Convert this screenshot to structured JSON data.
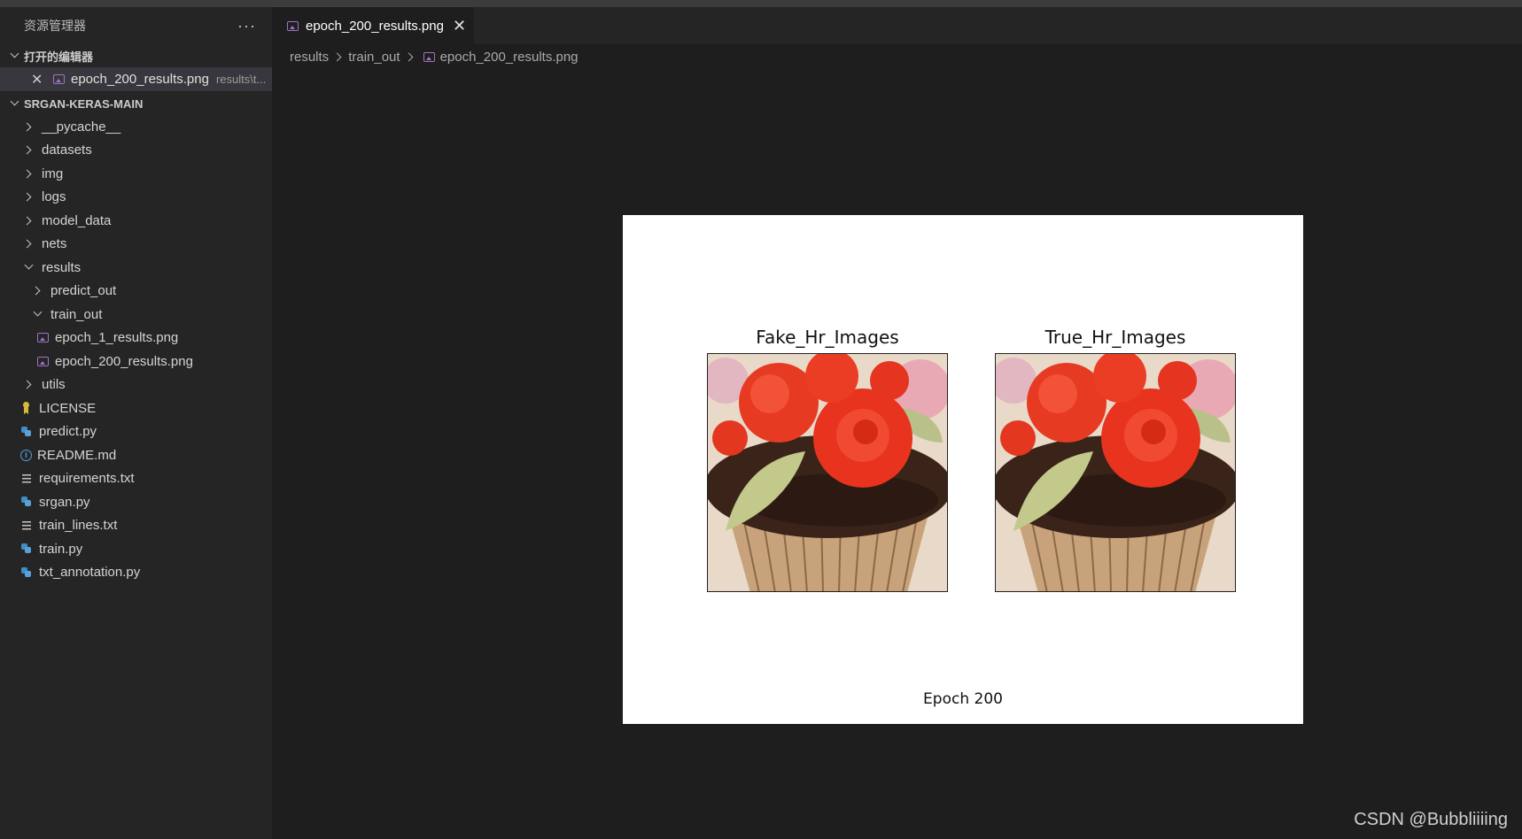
{
  "sidebar": {
    "title": "资源管理器",
    "more_label": "···",
    "open_editors": {
      "label": "打开的编辑器",
      "items": [
        {
          "name": "epoch_200_results.png",
          "path": "results\\t..."
        }
      ]
    },
    "project": {
      "label": "SRGAN-KERAS-MAIN",
      "tree": [
        {
          "label": "__pycache__",
          "type": "folder"
        },
        {
          "label": "datasets",
          "type": "folder"
        },
        {
          "label": "img",
          "type": "folder"
        },
        {
          "label": "logs",
          "type": "folder"
        },
        {
          "label": "model_data",
          "type": "folder"
        },
        {
          "label": "nets",
          "type": "folder"
        },
        {
          "label": "results",
          "type": "folder-open"
        },
        {
          "label": "predict_out",
          "type": "folder"
        },
        {
          "label": "train_out",
          "type": "folder-open"
        },
        {
          "label": "epoch_1_results.png",
          "type": "image"
        },
        {
          "label": "epoch_200_results.png",
          "type": "image"
        },
        {
          "label": "utils",
          "type": "folder"
        },
        {
          "label": "LICENSE",
          "type": "license"
        },
        {
          "label": "predict.py",
          "type": "python"
        },
        {
          "label": "README.md",
          "type": "info"
        },
        {
          "label": "requirements.txt",
          "type": "text"
        },
        {
          "label": "srgan.py",
          "type": "python"
        },
        {
          "label": "train_lines.txt",
          "type": "text"
        },
        {
          "label": "train.py",
          "type": "python"
        },
        {
          "label": "txt_annotation.py",
          "type": "python"
        }
      ]
    }
  },
  "tab": {
    "label": "epoch_200_results.png",
    "close": "✕"
  },
  "breadcrumb": [
    "results",
    "train_out",
    "epoch_200_results.png"
  ],
  "preview": {
    "left_title": "Fake_Hr_Images",
    "right_title": "True_Hr_Images",
    "caption": "Epoch 200"
  },
  "watermark": "CSDN @Bubbliiiing",
  "colors": {
    "accent": "#a074c4",
    "editor_bg": "#1e1e1e",
    "sidebar_bg": "#252526"
  }
}
